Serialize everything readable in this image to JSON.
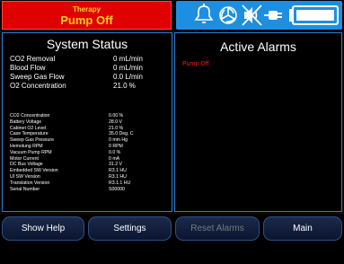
{
  "header": {
    "therapy_label": "Therapy",
    "therapy_state": "Pump Off",
    "status_icons": [
      "bell-icon",
      "pump-rotor-icon",
      "muted-speaker-icon",
      "plug-icon",
      "battery-icon"
    ]
  },
  "system_status": {
    "title": "System Status",
    "primary": [
      {
        "label": "CO2 Removal",
        "value": "0 mL/min"
      },
      {
        "label": "Blood Flow",
        "value": "0 mL/min"
      },
      {
        "label": "Sweep Gas Flow",
        "value": "0.0 L/min"
      },
      {
        "label": "O2 Concentration",
        "value": "21.0  %"
      }
    ],
    "details": [
      {
        "label": "CO2 Concentration",
        "value": "0.00 %"
      },
      {
        "label": "Battery Voltage",
        "value": "28.0 V"
      },
      {
        "label": "Cabinet O2 Level",
        "value": "21.0  %"
      },
      {
        "label": "Case Temperature",
        "value": "35.0 Deg. C"
      },
      {
        "label": "Sweep Gas Pressure",
        "value": "0 mm Hg"
      },
      {
        "label": "Hemolung RPM",
        "value": "0 RPM"
      },
      {
        "label": "Vacuum Pump RPM",
        "value": "0.0  %"
      },
      {
        "label": "Motor Current",
        "value": "0 mA"
      },
      {
        "label": "DC Bus Voltage",
        "value": "31.2 V"
      },
      {
        "label": "Embedded SW Version",
        "value": "R3.1 HU"
      },
      {
        "label": "UI SW Version",
        "value": "R3.1 HU"
      },
      {
        "label": "Translation Version",
        "value": "R3.1.1 HU"
      },
      {
        "label": "Serial Number",
        "value": "S00000"
      }
    ]
  },
  "alarms": {
    "title": "Active Alarms",
    "items": [
      "Pump Off"
    ]
  },
  "buttons": {
    "show_help": "Show Help",
    "settings": "Settings",
    "reset_alarms": "Reset Alarms",
    "main": "Main"
  },
  "colors": {
    "therapy_bg": "#e00000",
    "therapy_text": "#ffd21f",
    "icon_bar": "#1e8fe0",
    "panel_border": "#2d7bd0",
    "alarm_text": "#e22222"
  }
}
